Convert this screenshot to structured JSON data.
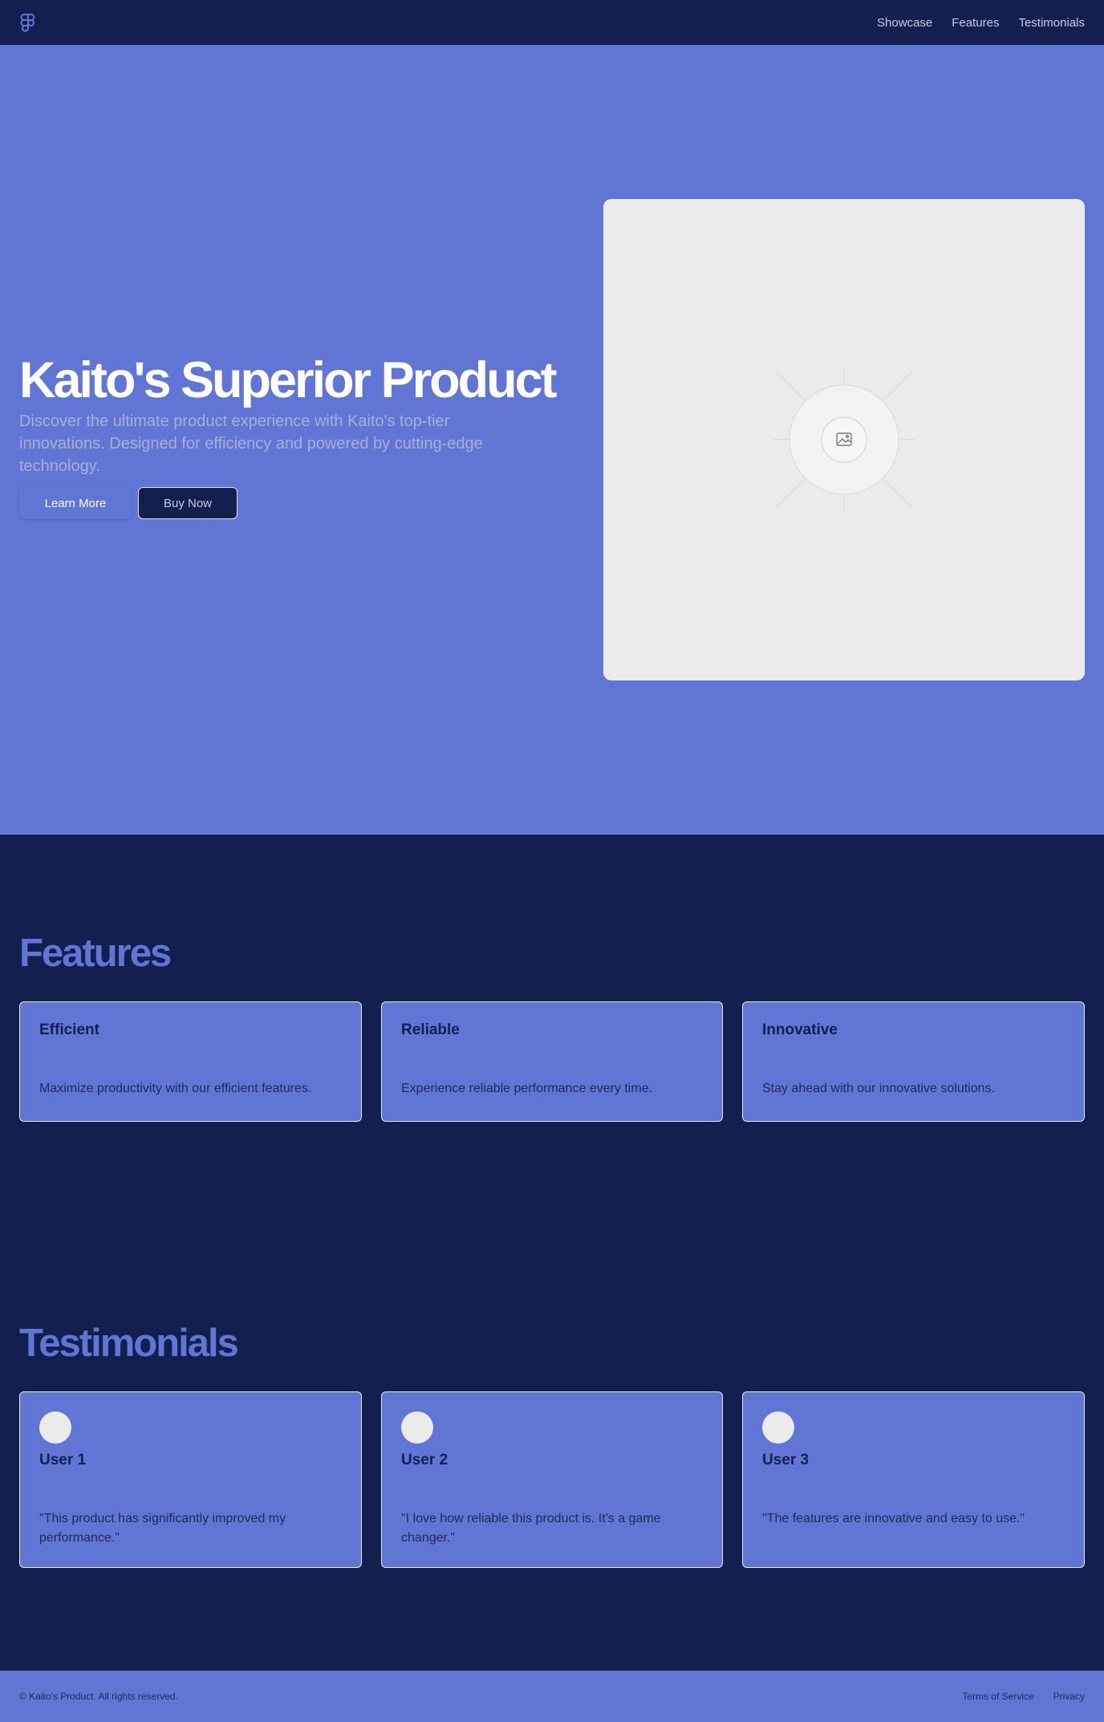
{
  "nav": {
    "logo_icon": "figma-logo-icon",
    "links": [
      "Showcase",
      "Features",
      "Testimonials"
    ]
  },
  "hero": {
    "title": "Kaito's Superior Product",
    "subtitle": "Discover the ultimate product experience with Kaito's top-tier innovations. Designed for efficiency and powered by cutting-edge technology.",
    "learn_more_label": "Learn More",
    "buy_now_label": "Buy Now",
    "image_icon": "image-placeholder-icon"
  },
  "features": {
    "title": "Features",
    "items": [
      {
        "title": "Efficient",
        "desc": "Maximize productivity with our efficient features."
      },
      {
        "title": "Reliable",
        "desc": "Experience reliable performance every time."
      },
      {
        "title": "Innovative",
        "desc": "Stay ahead with our innovative solutions."
      }
    ]
  },
  "testimonials": {
    "title": "Testimonials",
    "items": [
      {
        "name": "User 1",
        "quote": "\"This product has significantly improved my performance.\""
      },
      {
        "name": "User 2",
        "quote": "\"I love how reliable this product is. It's a game changer.\""
      },
      {
        "name": "User 3",
        "quote": "\"The features are innovative and easy to use.\""
      }
    ]
  },
  "footer": {
    "copyright": "© Kaito's Product. All rights reserved.",
    "links": [
      "Terms of Service",
      "Privacy"
    ]
  },
  "colors": {
    "navy": "#131f4f",
    "accent": "#6075d4",
    "placeholder": "#ebebeb"
  }
}
